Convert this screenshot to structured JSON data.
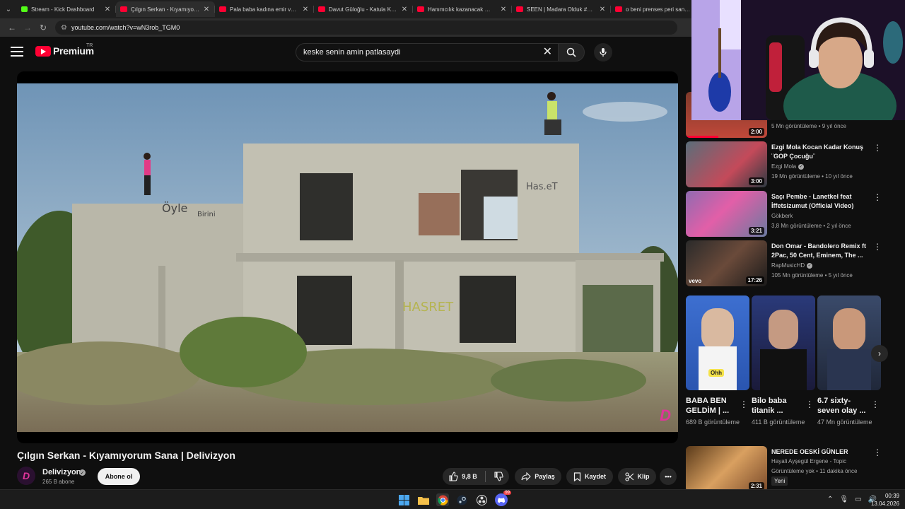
{
  "browser": {
    "tabs": [
      {
        "title": "Stream - Kick Dashboard",
        "type": "kick"
      },
      {
        "title": "Çılgın Serkan - Kıyamıyorum",
        "type": "youtube"
      },
      {
        "title": "Pala baba kadına emir verilçi",
        "type": "youtube"
      },
      {
        "title": "Davut Güloğlu - Katula Katul",
        "type": "youtube"
      },
      {
        "title": "Hanımcılık kazanacak 🤩 #a",
        "type": "youtube"
      },
      {
        "title": "SEEN | Madara Olduk #681",
        "type": "youtube"
      },
      {
        "title": "o beni prenses peri sanıyor",
        "type": "youtube"
      }
    ],
    "url": "youtube.com/watch?v=wN3rob_TGM0"
  },
  "header": {
    "logo_text": "Premium",
    "region": "TR",
    "search_query": "keske senin amin patlasaydi"
  },
  "video": {
    "title": "Çılgın Serkan - Kıyamıyorum Sana | Delivizyon",
    "channel": "Delivizyon",
    "subscribers": "265 B abone",
    "subscribe_label": "Abone ol",
    "likes": "9,8 B",
    "share_label": "Paylaş",
    "save_label": "Kaydet",
    "clip_label": "Klip",
    "watermark": "D"
  },
  "sidebar": {
    "partial_item": {
      "meta": "5 Mn görüntüleme • 9 yıl önce",
      "duration": "2:00"
    },
    "recommendations": [
      {
        "title": "Ezgi Mola Kocan Kadar Konuş ¨GOP Çocuğu¨",
        "channel": "Ezgi Mola",
        "verified": true,
        "meta": "19 Mn görüntüleme • 10 yıl önce",
        "duration": "3:00"
      },
      {
        "title": "Saçı Pembe - Lanetkel feat İffetsizumut (Official Video)",
        "channel": "Gökberk",
        "verified": false,
        "meta": "3,8 Mn görüntüleme • 2 yıl önce",
        "duration": "3:21"
      },
      {
        "title": "Don Omar - Bandolero Remix ft 2Pac, 50 Cent, Eminem, The ...",
        "channel": "RapMusicHD",
        "verified": true,
        "meta": "105 Mn görüntüleme • 5 yıl önce",
        "duration": "17:26",
        "label": "vevo"
      }
    ],
    "shorts": [
      {
        "title": "BABA BEN GELDİM | ...",
        "views": "689 B görüntüleme",
        "caption": "Ohh"
      },
      {
        "title": "Bilo baba titanik ...",
        "views": "411 B görüntüleme"
      },
      {
        "title": "6.7 sixty-seven olay ...",
        "views": "47 Mn görüntüleme"
      }
    ],
    "bottom_item": {
      "title": "NEREDE OESKİ GÜNLER",
      "channel": "Hayali Ayşegül Ergene - Topic",
      "meta": "Görüntüleme yok • 11 dakika önce",
      "badge": "Yeni",
      "duration": "2:31"
    }
  },
  "taskbar": {
    "time": "00:39",
    "date": "13.04.2026",
    "notification_count": "99"
  },
  "colors": {
    "background": "#0f0f0f",
    "yt_red": "#ff0033",
    "kick_green": "#53fc18",
    "channel_pink": "#e0359a"
  }
}
